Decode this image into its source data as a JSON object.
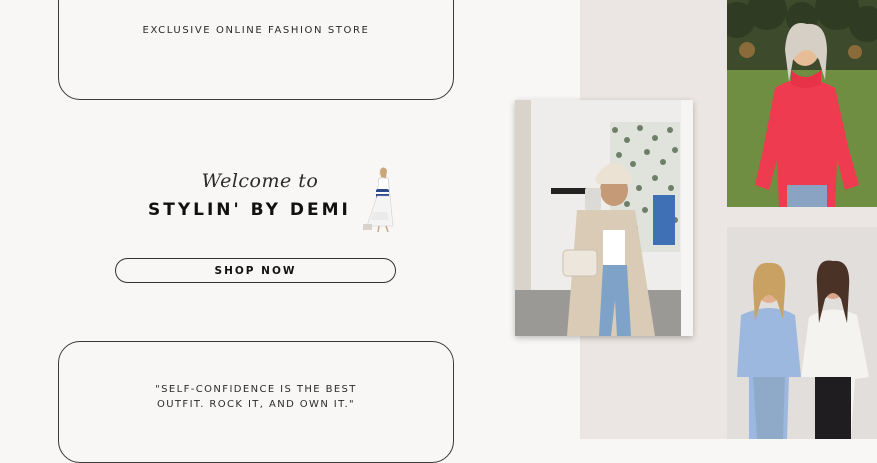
{
  "header": {
    "tagline": "EXCLUSIVE ONLINE FASHION STORE"
  },
  "hero": {
    "welcome": "Welcome to",
    "brand": "STYLIN' BY DEMI",
    "cta_label": "SHOP NOW"
  },
  "quote": {
    "line1": "\"SELF-CONFIDENCE IS THE BEST",
    "line2": "OUTFIT. ROCK IT, AND OWN IT.\""
  },
  "gallery": {
    "photos": [
      "mirror-selfie-photo",
      "red-sweater-photo",
      "two-friends-photo"
    ]
  },
  "colors": {
    "background": "#f8f7f5",
    "accent_panel": "#ebe6e3",
    "ink": "#1b1b1b"
  }
}
